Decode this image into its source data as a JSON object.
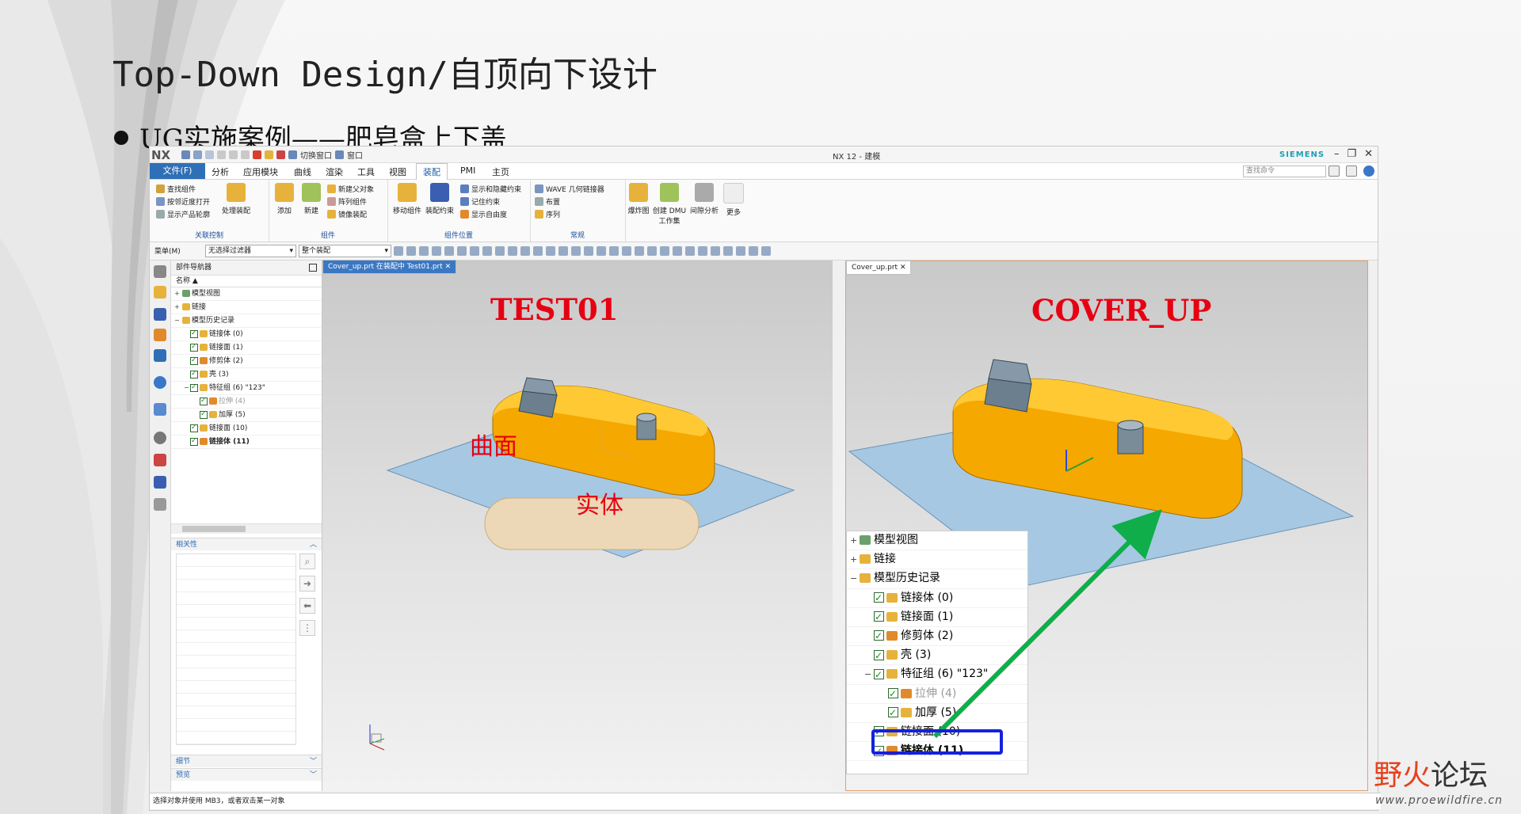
{
  "slide": {
    "title": "Top-Down Design/自顶向下设计",
    "bullet": "UG实施案例——肥皂盒上下盖"
  },
  "window": {
    "logo": "NX",
    "title": "NX 12 - 建模",
    "brand": "SIEMENS",
    "quick_access": [
      "切换窗口",
      "窗口"
    ]
  },
  "menubar": {
    "file": "文件(F)",
    "tabs": [
      "分析",
      "应用模块",
      "曲线",
      "渲染",
      "工具",
      "视图",
      "装配",
      "PMI",
      "主页"
    ],
    "active_tab": "装配",
    "search_placeholder": "查找命令"
  },
  "ribbon": {
    "groups": [
      {
        "label": "关联控制",
        "items": [
          "查找组件",
          "按邻近度打开",
          "显示产品轮廓",
          "处理装配"
        ]
      },
      {
        "label": "组件",
        "items": [
          "添加",
          "新建",
          "新建父对象",
          "阵列组件",
          "镜像装配"
        ]
      },
      {
        "label": "组件位置",
        "items": [
          "移动组件",
          "装配约束",
          "显示和隐藏约束",
          "记住约束",
          "显示自由度"
        ]
      },
      {
        "label": "常规",
        "items": [
          "WAVE 几何链接器",
          "布置",
          "序列"
        ]
      },
      {
        "label": "",
        "items": [
          "爆炸图",
          "创建 DMU 工作集",
          "间隙分析",
          "更多"
        ]
      }
    ]
  },
  "selection_bar": {
    "menu": "菜单(M)",
    "filter": "无选择过滤器",
    "scope": "整个装配"
  },
  "part_navigator": {
    "title": "部件导航器",
    "column": "名称",
    "rows": [
      {
        "label": "模型视图",
        "level": 0,
        "expander": "+",
        "checked": false,
        "style": ""
      },
      {
        "label": "链接",
        "level": 0,
        "expander": "+",
        "checked": false,
        "style": ""
      },
      {
        "label": "模型历史记录",
        "level": 0,
        "expander": "−",
        "checked": false,
        "style": ""
      },
      {
        "label": "链接体 (0)",
        "level": 1,
        "expander": "",
        "checked": true,
        "style": ""
      },
      {
        "label": "链接面 (1)",
        "level": 1,
        "expander": "",
        "checked": true,
        "style": ""
      },
      {
        "label": "修剪体 (2)",
        "level": 1,
        "expander": "",
        "checked": true,
        "style": ""
      },
      {
        "label": "壳 (3)",
        "level": 1,
        "expander": "",
        "checked": true,
        "style": ""
      },
      {
        "label": "特征组 (6) \"123\"",
        "level": 1,
        "expander": "−",
        "checked": true,
        "style": ""
      },
      {
        "label": "拉伸 (4)",
        "level": 2,
        "expander": "",
        "checked": true,
        "style": "grey"
      },
      {
        "label": "加厚 (5)",
        "level": 2,
        "expander": "",
        "checked": true,
        "style": ""
      },
      {
        "label": "链接面 (10)",
        "level": 1,
        "expander": "",
        "checked": true,
        "style": ""
      },
      {
        "label": "链接体 (11)",
        "level": 1,
        "expander": "",
        "checked": true,
        "style": "bold"
      }
    ],
    "sections": {
      "dependencies": "相关性",
      "details": "细节",
      "preview": "预览"
    }
  },
  "viewport_left": {
    "tab": "Cover_up.prt 在装配中 Test01.prt",
    "label": "TEST01",
    "annotation_surface": "曲面",
    "annotation_solid": "实体"
  },
  "viewport_right": {
    "tab": "Cover_up.prt",
    "label": "COVER_UP"
  },
  "overlay_tree": {
    "rows": [
      {
        "label": "模型视图",
        "level": 0,
        "expander": "+",
        "checked": false,
        "style": ""
      },
      {
        "label": "链接",
        "level": 0,
        "expander": "+",
        "checked": false,
        "style": ""
      },
      {
        "label": "模型历史记录",
        "level": 0,
        "expander": "−",
        "checked": false,
        "style": ""
      },
      {
        "label": "链接体 (0)",
        "level": 1,
        "expander": "",
        "checked": true,
        "style": ""
      },
      {
        "label": "链接面 (1)",
        "level": 1,
        "expander": "",
        "checked": true,
        "style": ""
      },
      {
        "label": "修剪体 (2)",
        "level": 1,
        "expander": "",
        "checked": true,
        "style": ""
      },
      {
        "label": "壳 (3)",
        "level": 1,
        "expander": "",
        "checked": true,
        "style": ""
      },
      {
        "label": "特征组 (6) \"123\"",
        "level": 1,
        "expander": "−",
        "checked": true,
        "style": ""
      },
      {
        "label": "拉伸 (4)",
        "level": 2,
        "expander": "",
        "checked": true,
        "style": "grey"
      },
      {
        "label": "加厚 (5)",
        "level": 2,
        "expander": "",
        "checked": true,
        "style": ""
      },
      {
        "label": "链接面 (10)",
        "level": 1,
        "expander": "",
        "checked": true,
        "style": ""
      },
      {
        "label": "链接体 (11)",
        "level": 1,
        "expander": "",
        "checked": true,
        "style": "bold"
      }
    ]
  },
  "status_bar": "选择对象并使用 MB3，或者双击某一对象",
  "watermark": {
    "ye": "野火",
    "rest": "论坛",
    "url": "www.proewildfire.cn"
  },
  "colors": {
    "accent": "#2f6fb7",
    "annotation_red": "#e60012",
    "part_orange": "#f5a800",
    "arrow_green": "#0fae4a",
    "highlight_blue": "#1520e0"
  }
}
